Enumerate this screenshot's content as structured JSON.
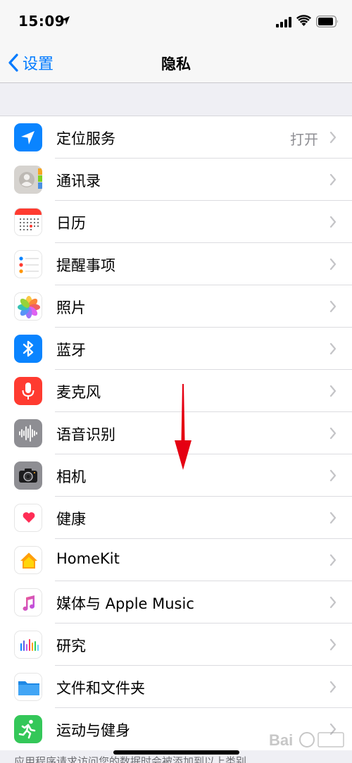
{
  "status_bar": {
    "time": "15:09"
  },
  "nav": {
    "back_label": "设置",
    "title": "隐私"
  },
  "rows": [
    {
      "label": "定位服务",
      "value": "打开",
      "icon": "location-icon"
    },
    {
      "label": "通讯录",
      "icon": "contacts-icon"
    },
    {
      "label": "日历",
      "icon": "calendar-icon"
    },
    {
      "label": "提醒事项",
      "icon": "reminders-icon"
    },
    {
      "label": "照片",
      "icon": "photos-icon"
    },
    {
      "label": "蓝牙",
      "icon": "bluetooth-icon"
    },
    {
      "label": "麦克风",
      "icon": "microphone-icon"
    },
    {
      "label": "语音识别",
      "icon": "speech-recognition-icon"
    },
    {
      "label": "相机",
      "icon": "camera-icon"
    },
    {
      "label": "健康",
      "icon": "health-icon"
    },
    {
      "label": "HomeKit",
      "icon": "homekit-icon"
    },
    {
      "label": "媒体与 Apple Music",
      "icon": "music-icon"
    },
    {
      "label": "研究",
      "icon": "research-icon"
    },
    {
      "label": "文件和文件夹",
      "icon": "files-icon"
    },
    {
      "label": "运动与健身",
      "icon": "fitness-icon"
    }
  ],
  "footer_text": "应用程序请求访问您的数据时会被添加到以上类别",
  "colors": {
    "accent": "#007aff",
    "annotation": "#e50012"
  }
}
